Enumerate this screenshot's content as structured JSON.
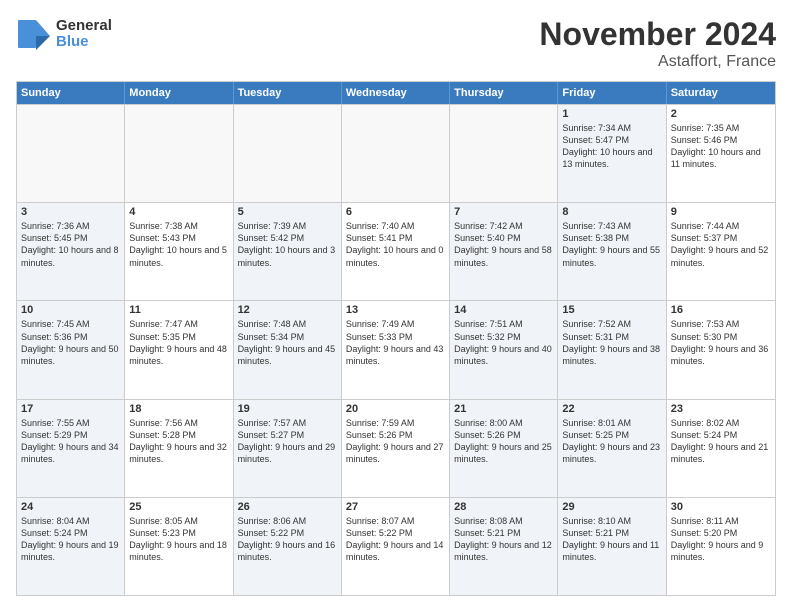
{
  "header": {
    "logo_line1": "General",
    "logo_line2": "Blue",
    "month": "November 2024",
    "location": "Astaffort, France"
  },
  "weekdays": [
    "Sunday",
    "Monday",
    "Tuesday",
    "Wednesday",
    "Thursday",
    "Friday",
    "Saturday"
  ],
  "rows": [
    [
      {
        "day": "",
        "info": "",
        "empty": true
      },
      {
        "day": "",
        "info": "",
        "empty": true
      },
      {
        "day": "",
        "info": "",
        "empty": true
      },
      {
        "day": "",
        "info": "",
        "empty": true
      },
      {
        "day": "",
        "info": "",
        "empty": true
      },
      {
        "day": "1",
        "info": "Sunrise: 7:34 AM\nSunset: 5:47 PM\nDaylight: 10 hours and 13 minutes.",
        "shaded": true
      },
      {
        "day": "2",
        "info": "Sunrise: 7:35 AM\nSunset: 5:46 PM\nDaylight: 10 hours and 11 minutes.",
        "shaded": false
      }
    ],
    [
      {
        "day": "3",
        "info": "Sunrise: 7:36 AM\nSunset: 5:45 PM\nDaylight: 10 hours and 8 minutes.",
        "shaded": true
      },
      {
        "day": "4",
        "info": "Sunrise: 7:38 AM\nSunset: 5:43 PM\nDaylight: 10 hours and 5 minutes.",
        "shaded": false
      },
      {
        "day": "5",
        "info": "Sunrise: 7:39 AM\nSunset: 5:42 PM\nDaylight: 10 hours and 3 minutes.",
        "shaded": true
      },
      {
        "day": "6",
        "info": "Sunrise: 7:40 AM\nSunset: 5:41 PM\nDaylight: 10 hours and 0 minutes.",
        "shaded": false
      },
      {
        "day": "7",
        "info": "Sunrise: 7:42 AM\nSunset: 5:40 PM\nDaylight: 9 hours and 58 minutes.",
        "shaded": true
      },
      {
        "day": "8",
        "info": "Sunrise: 7:43 AM\nSunset: 5:38 PM\nDaylight: 9 hours and 55 minutes.",
        "shaded": true
      },
      {
        "day": "9",
        "info": "Sunrise: 7:44 AM\nSunset: 5:37 PM\nDaylight: 9 hours and 52 minutes.",
        "shaded": false
      }
    ],
    [
      {
        "day": "10",
        "info": "Sunrise: 7:45 AM\nSunset: 5:36 PM\nDaylight: 9 hours and 50 minutes.",
        "shaded": true
      },
      {
        "day": "11",
        "info": "Sunrise: 7:47 AM\nSunset: 5:35 PM\nDaylight: 9 hours and 48 minutes.",
        "shaded": false
      },
      {
        "day": "12",
        "info": "Sunrise: 7:48 AM\nSunset: 5:34 PM\nDaylight: 9 hours and 45 minutes.",
        "shaded": true
      },
      {
        "day": "13",
        "info": "Sunrise: 7:49 AM\nSunset: 5:33 PM\nDaylight: 9 hours and 43 minutes.",
        "shaded": false
      },
      {
        "day": "14",
        "info": "Sunrise: 7:51 AM\nSunset: 5:32 PM\nDaylight: 9 hours and 40 minutes.",
        "shaded": true
      },
      {
        "day": "15",
        "info": "Sunrise: 7:52 AM\nSunset: 5:31 PM\nDaylight: 9 hours and 38 minutes.",
        "shaded": true
      },
      {
        "day": "16",
        "info": "Sunrise: 7:53 AM\nSunset: 5:30 PM\nDaylight: 9 hours and 36 minutes.",
        "shaded": false
      }
    ],
    [
      {
        "day": "17",
        "info": "Sunrise: 7:55 AM\nSunset: 5:29 PM\nDaylight: 9 hours and 34 minutes.",
        "shaded": true
      },
      {
        "day": "18",
        "info": "Sunrise: 7:56 AM\nSunset: 5:28 PM\nDaylight: 9 hours and 32 minutes.",
        "shaded": false
      },
      {
        "day": "19",
        "info": "Sunrise: 7:57 AM\nSunset: 5:27 PM\nDaylight: 9 hours and 29 minutes.",
        "shaded": true
      },
      {
        "day": "20",
        "info": "Sunrise: 7:59 AM\nSunset: 5:26 PM\nDaylight: 9 hours and 27 minutes.",
        "shaded": false
      },
      {
        "day": "21",
        "info": "Sunrise: 8:00 AM\nSunset: 5:26 PM\nDaylight: 9 hours and 25 minutes.",
        "shaded": true
      },
      {
        "day": "22",
        "info": "Sunrise: 8:01 AM\nSunset: 5:25 PM\nDaylight: 9 hours and 23 minutes.",
        "shaded": true
      },
      {
        "day": "23",
        "info": "Sunrise: 8:02 AM\nSunset: 5:24 PM\nDaylight: 9 hours and 21 minutes.",
        "shaded": false
      }
    ],
    [
      {
        "day": "24",
        "info": "Sunrise: 8:04 AM\nSunset: 5:24 PM\nDaylight: 9 hours and 19 minutes.",
        "shaded": true
      },
      {
        "day": "25",
        "info": "Sunrise: 8:05 AM\nSunset: 5:23 PM\nDaylight: 9 hours and 18 minutes.",
        "shaded": false
      },
      {
        "day": "26",
        "info": "Sunrise: 8:06 AM\nSunset: 5:22 PM\nDaylight: 9 hours and 16 minutes.",
        "shaded": true
      },
      {
        "day": "27",
        "info": "Sunrise: 8:07 AM\nSunset: 5:22 PM\nDaylight: 9 hours and 14 minutes.",
        "shaded": false
      },
      {
        "day": "28",
        "info": "Sunrise: 8:08 AM\nSunset: 5:21 PM\nDaylight: 9 hours and 12 minutes.",
        "shaded": true
      },
      {
        "day": "29",
        "info": "Sunrise: 8:10 AM\nSunset: 5:21 PM\nDaylight: 9 hours and 11 minutes.",
        "shaded": true
      },
      {
        "day": "30",
        "info": "Sunrise: 8:11 AM\nSunset: 5:20 PM\nDaylight: 9 hours and 9 minutes.",
        "shaded": false
      }
    ]
  ]
}
